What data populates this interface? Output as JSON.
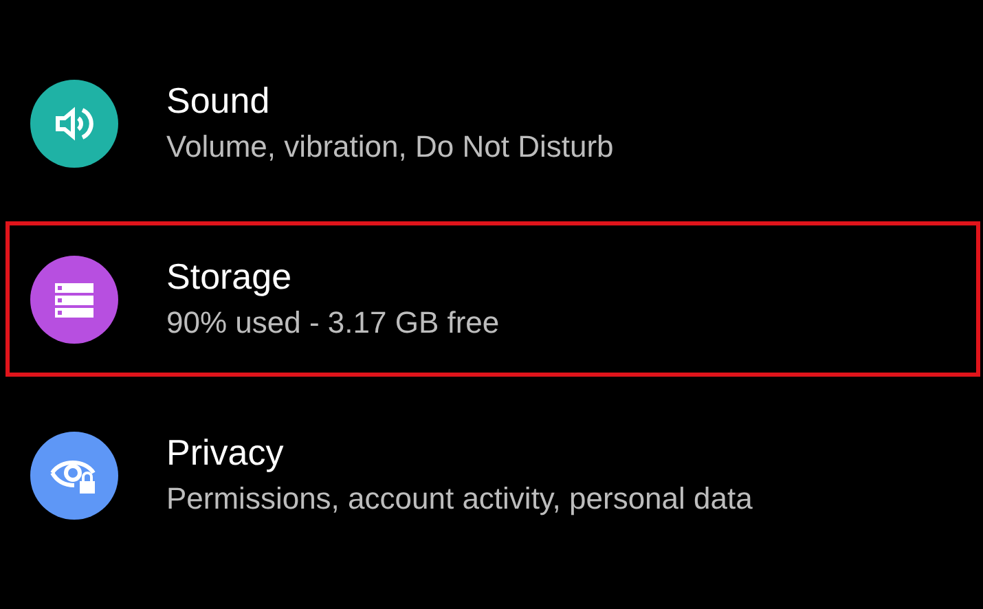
{
  "settings_items": [
    {
      "kind": "sound",
      "title": "Sound",
      "subtitle": "Volume, vibration, Do Not Disturb",
      "color": "#1fb2a5",
      "highlighted": false
    },
    {
      "kind": "storage",
      "title": "Storage",
      "subtitle": "90% used - 3.17 GB free",
      "color": "#b74fe0",
      "highlighted": true
    },
    {
      "kind": "privacy",
      "title": "Privacy",
      "subtitle": "Permissions, account activity, personal data",
      "color": "#5e97f6",
      "highlighted": false
    }
  ]
}
